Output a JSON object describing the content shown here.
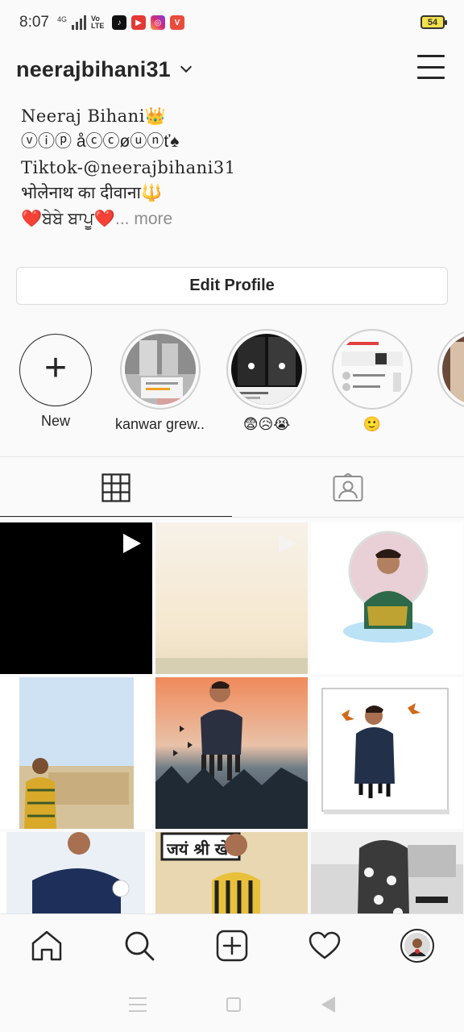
{
  "status_bar": {
    "time": "8:07",
    "network": "4G",
    "volte": "Vo LTE",
    "battery": "54"
  },
  "header": {
    "username": "neerajbihani31",
    "dropdown_icon": "chevron-down-icon",
    "menu_icon": "hamburger-menu-icon"
  },
  "bio": {
    "name": "Neeraj Bihani👑",
    "line2": "ⓥⓘⓟ åⓒⓒøⓤⓝť♠",
    "line3": "Tiktok-@neerajbihani31",
    "line4": "भोलेनाथ का दीवाना🔱",
    "line5": "❤️ਬੇਬੇ ਬਾਪੂ❤️",
    "more": "... more"
  },
  "edit_profile_label": "Edit Profile",
  "highlights": [
    {
      "label": "New"
    },
    {
      "label": "kanwar grew..."
    },
    {
      "label": "😨😥😭"
    },
    {
      "label": "🙂"
    },
    {
      "label": ""
    }
  ],
  "tabs": [
    {
      "name": "grid",
      "icon": "grid-icon",
      "active": true
    },
    {
      "name": "tagged",
      "icon": "tagged-person-icon",
      "active": false
    }
  ],
  "grid_posts": [
    {
      "type": "video",
      "bg": "#000000"
    },
    {
      "type": "video",
      "bg": "#f3ece0"
    },
    {
      "type": "photo",
      "bg": "#ffffff"
    },
    {
      "type": "photo",
      "bg": "#cfe0f2"
    },
    {
      "type": "photo",
      "bg": "#4a5660"
    },
    {
      "type": "photo",
      "bg": "#ffffff"
    },
    {
      "type": "photo",
      "bg": "#eaf0f6"
    },
    {
      "type": "photo",
      "bg": "#e8d7b0"
    },
    {
      "type": "photo",
      "bg": "#d8d8d8"
    }
  ],
  "bottom_nav": [
    {
      "name": "home",
      "icon": "home-icon"
    },
    {
      "name": "search",
      "icon": "search-icon"
    },
    {
      "name": "new-post",
      "icon": "add-post-icon"
    },
    {
      "name": "activity",
      "icon": "heart-icon"
    },
    {
      "name": "profile",
      "icon": "profile-avatar-icon"
    }
  ]
}
